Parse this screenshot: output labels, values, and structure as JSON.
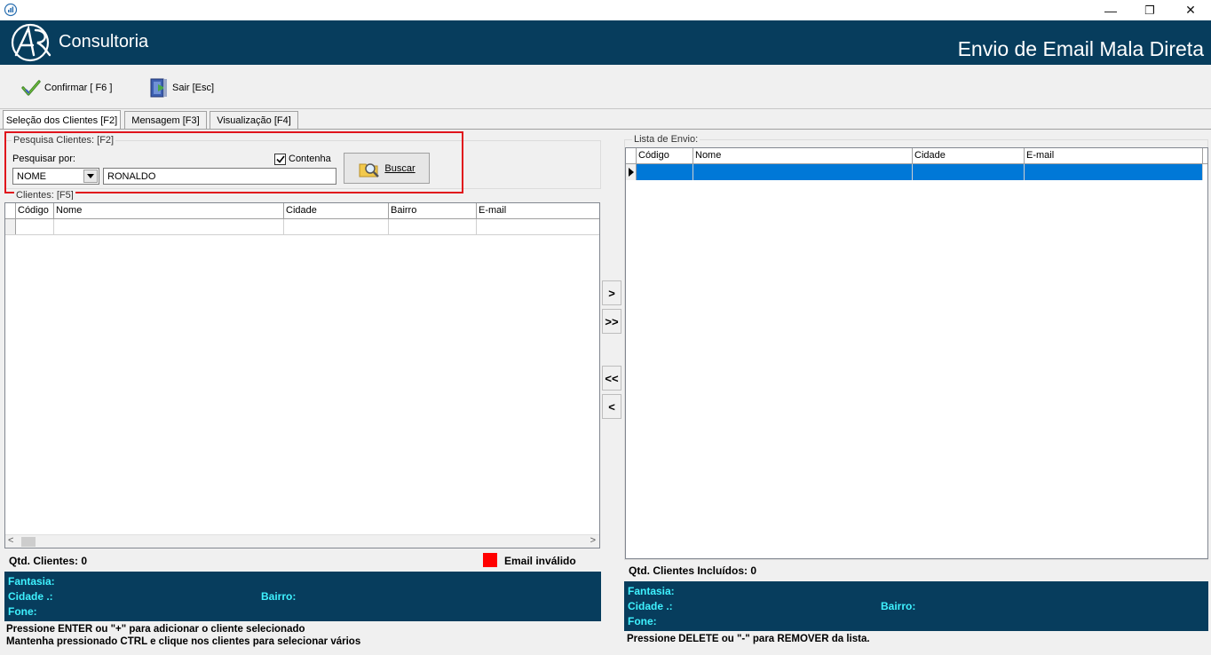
{
  "window": {
    "minimize_glyph": "—",
    "restore_glyph": "❐",
    "close_glyph": "✕"
  },
  "header": {
    "brand": "Consultoria",
    "title": "Envio de Email Mala Direta",
    "bg_color": "#073d5d"
  },
  "toolbar": {
    "confirm_label": "Confirmar [ F6 ]",
    "exit_label": "Sair  [Esc]"
  },
  "tabs": [
    {
      "label": "Seleção dos Clientes [F2]"
    },
    {
      "label": "Mensagem [F3]"
    },
    {
      "label": "Visualização [F4]"
    }
  ],
  "search": {
    "group_label": "Pesquisa Clientes: [F2]",
    "search_by_label": "Pesquisar por:",
    "search_by_value": "NOME",
    "contains_label": "Contenha",
    "contains_checked": true,
    "query_value": "RONALDO",
    "search_button": "Buscar"
  },
  "clients": {
    "group_label": "Clientes: [F5]",
    "columns": [
      "Código",
      "Nome",
      "Cidade",
      "Bairro",
      "E-mail"
    ],
    "count_label": "Qtd. Clientes: 0",
    "invalid_email_label": "Email inválido",
    "invalid_color": "#ff0000",
    "info": {
      "fantasia": "Fantasia:",
      "cidade": "Cidade .:",
      "bairro": "Bairro:",
      "fone": "Fone:"
    },
    "hint1": "Pressione ENTER ou \"+\" para adicionar o cliente selecionado",
    "hint2": "Mantenha pressionado CTRL e clique nos clientes para selecionar vários"
  },
  "transfer": {
    "add_one": ">",
    "add_all": ">>",
    "remove_all": "<<",
    "remove_one": "<"
  },
  "send_list": {
    "group_label": "Lista de Envio:",
    "columns": [
      "Código",
      "Nome",
      "Cidade",
      "E-mail"
    ],
    "selected_color": "#0078d7",
    "count_label": "Qtd. Clientes Incluídos: 0",
    "info": {
      "fantasia": "Fantasia:",
      "cidade": "Cidade .:",
      "bairro": "Bairro:",
      "fone": "Fone:"
    },
    "hint": "Pressione DELETE ou \"-\" para REMOVER da lista."
  }
}
